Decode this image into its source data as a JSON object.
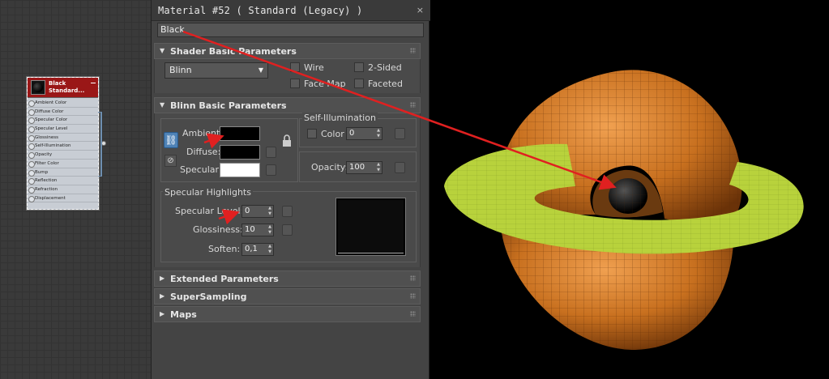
{
  "slate": {
    "node_name_line1": "Black",
    "node_name_line2": "Standard...",
    "slots": [
      "Ambient Color",
      "Diffuse Color",
      "Specular Color",
      "Specular Level",
      "Glossiness",
      "Self-Illumination",
      "Opacity",
      "Filter Color",
      "Bump",
      "Reflection",
      "Refraction",
      "Displacement"
    ]
  },
  "editor": {
    "title": "Material #52  ( Standard (Legacy) )",
    "close_icon": "×",
    "material_name": "Black",
    "shader_rollout": {
      "label": "Shader Basic Parameters",
      "shader": "Blinn",
      "wire": "Wire",
      "two_sided": "2-Sided",
      "face_map": "Face Map",
      "faceted": "Faceted"
    },
    "blinn_rollout": {
      "label": "Blinn Basic Parameters",
      "ambient": "Ambient:",
      "diffuse": "Diffuse:",
      "specular": "Specular:",
      "ambient_color": "#000000",
      "diffuse_color": "#000000",
      "specular_color": "#ffffff",
      "self_illum_title": "Self-Illumination",
      "color": "Color",
      "color_value": "0",
      "opacity": "Opacity:",
      "opacity_value": "100",
      "spec_highlights_title": "Specular Highlights",
      "specular_level": "Specular Level:",
      "specular_level_value": "0",
      "glossiness": "Glossiness:",
      "glossiness_value": "10",
      "soften": "Soften:",
      "soften_value": "0,1"
    },
    "collapsed_rollouts": [
      "Extended Parameters",
      "SuperSampling",
      "Maps"
    ]
  },
  "viewport": {
    "torus_color": "#c8701f",
    "ring_color": "#b8d23c",
    "annotation_color": "#e02020"
  }
}
